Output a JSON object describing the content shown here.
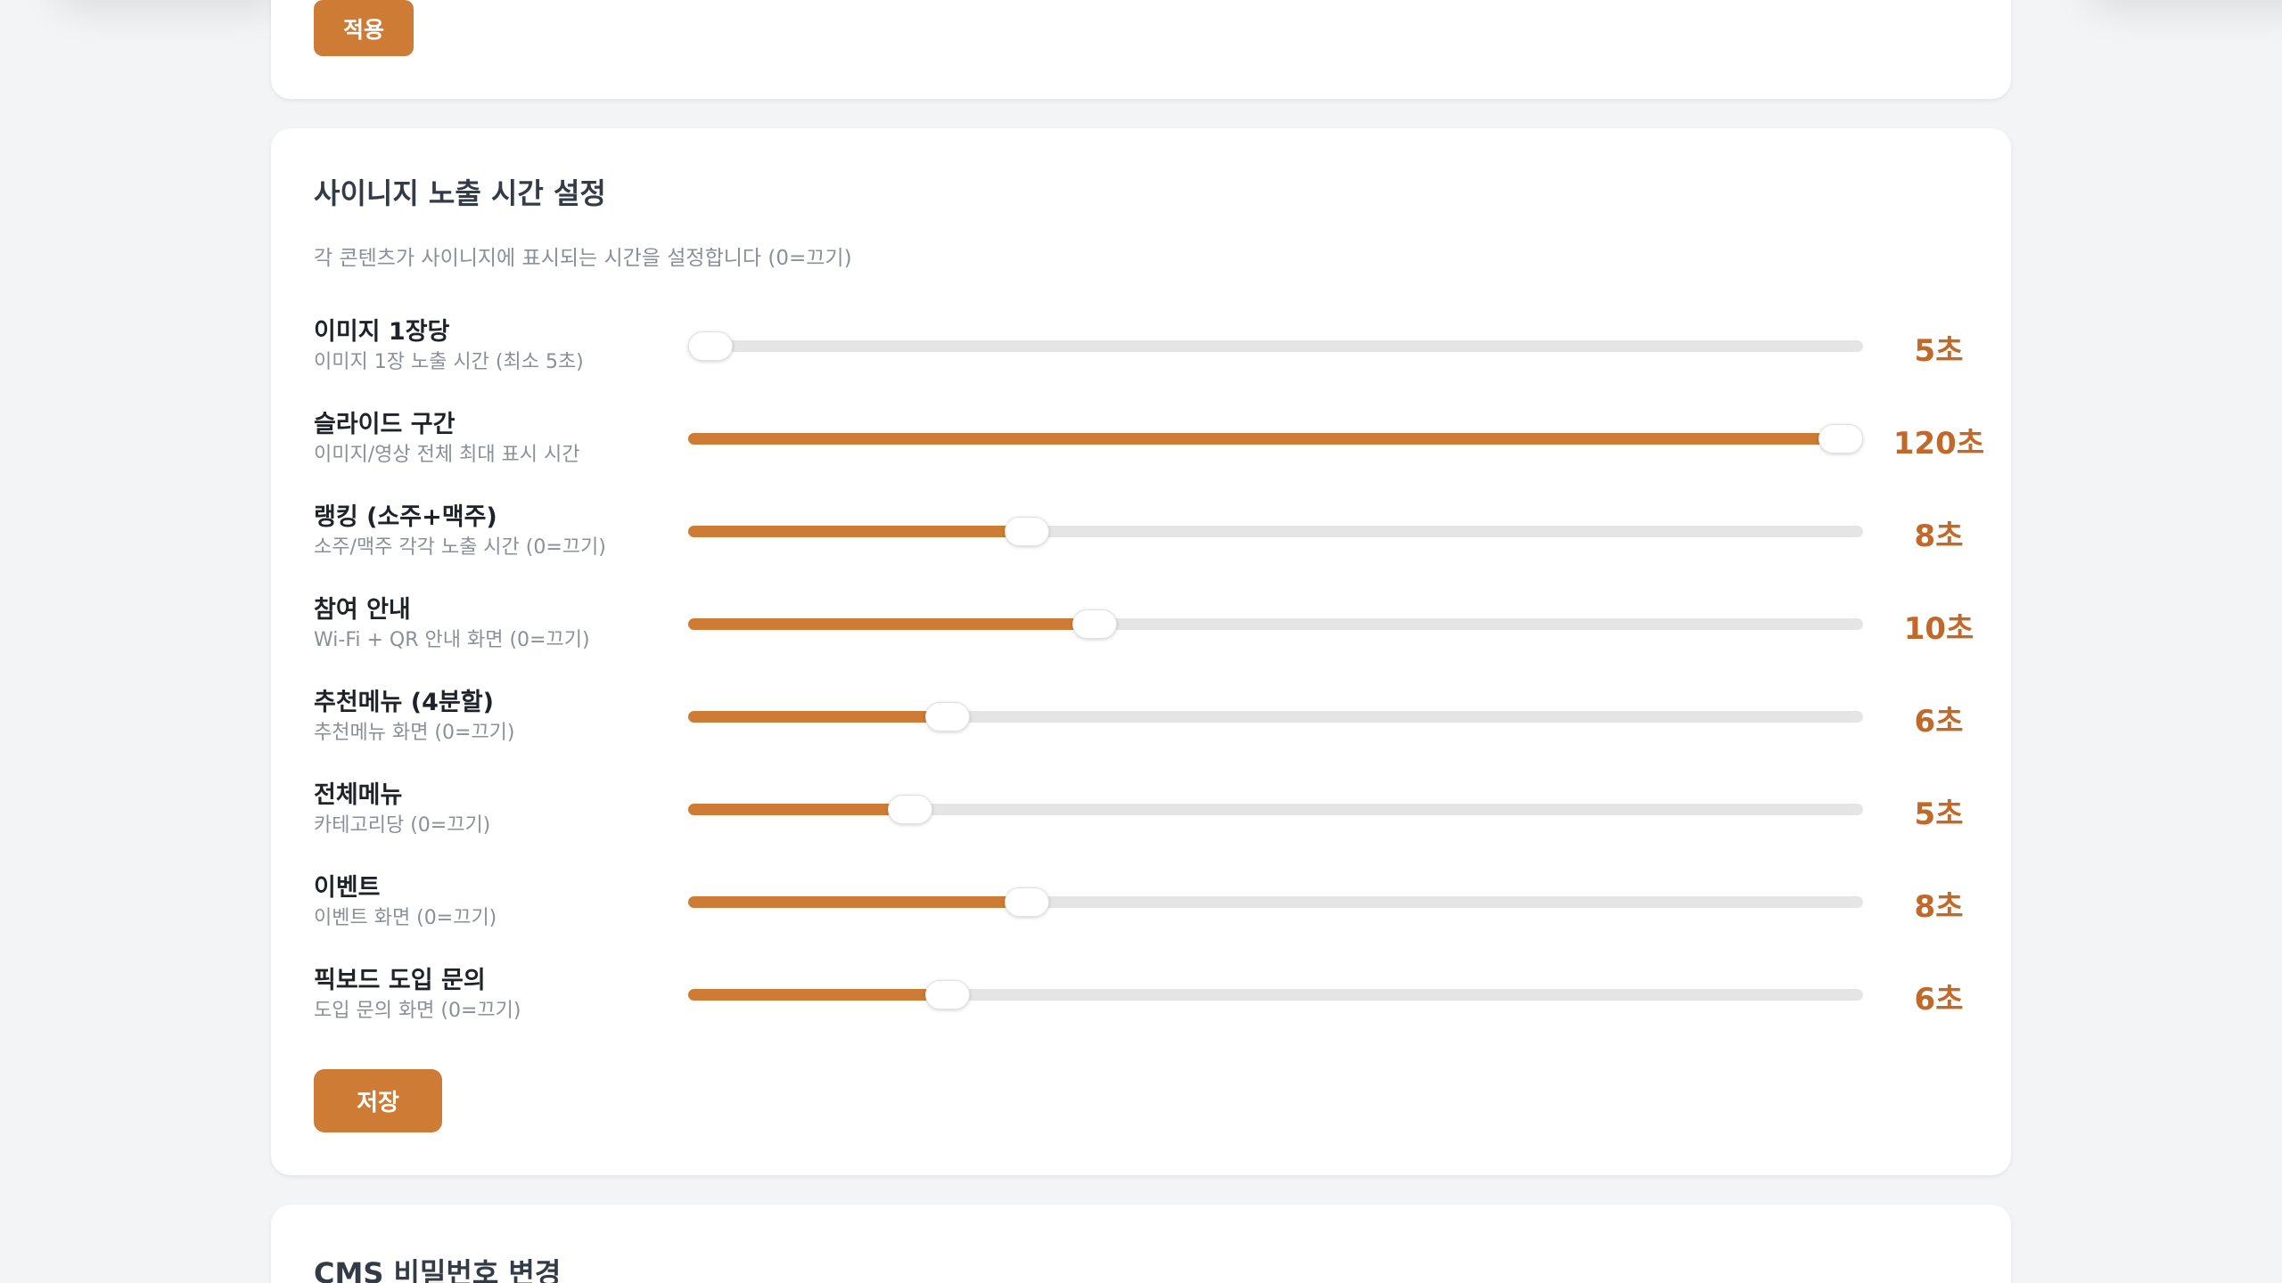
{
  "top_card": {
    "apply_label": "적용"
  },
  "signage": {
    "title": "사이니지 노출 시간 설정",
    "description": "각 콘텐츠가 사이니지에 표시되는 시간을 설정합니다 (0=끄기)",
    "accent_color": "#cd7b35",
    "track_color": "#e5e5e5",
    "rows": [
      {
        "title": "이미지 1장당",
        "subtitle": "이미지 1장 노출 시간 (최소 5초)",
        "value": "5초",
        "level": 0.0
      },
      {
        "title": "슬라이드 구간",
        "subtitle": "이미지/영상 전체 최대 표시 시간",
        "value": "120초",
        "level": 1.0
      },
      {
        "title": "랭킹 (소주+맥주)",
        "subtitle": "소주/맥주 각각 노출 시간 (0=끄기)",
        "value": "8초",
        "level": 0.28
      },
      {
        "title": "참여 안내",
        "subtitle": "Wi-Fi + QR 안내 화면 (0=끄기)",
        "value": "10초",
        "level": 0.34
      },
      {
        "title": "추천메뉴 (4분할)",
        "subtitle": "추천메뉴 화면 (0=끄기)",
        "value": "6초",
        "level": 0.21
      },
      {
        "title": "전체메뉴",
        "subtitle": "카테고리당 (0=끄기)",
        "value": "5초",
        "level": 0.177
      },
      {
        "title": "이벤트",
        "subtitle": "이벤트 화면 (0=끄기)",
        "value": "8초",
        "level": 0.28
      },
      {
        "title": "픽보드 도입 문의",
        "subtitle": "도입 문의 화면 (0=끄기)",
        "value": "6초",
        "level": 0.21
      }
    ],
    "save_label": "저장"
  },
  "password": {
    "title": "CMS 비밀번호 변경"
  }
}
